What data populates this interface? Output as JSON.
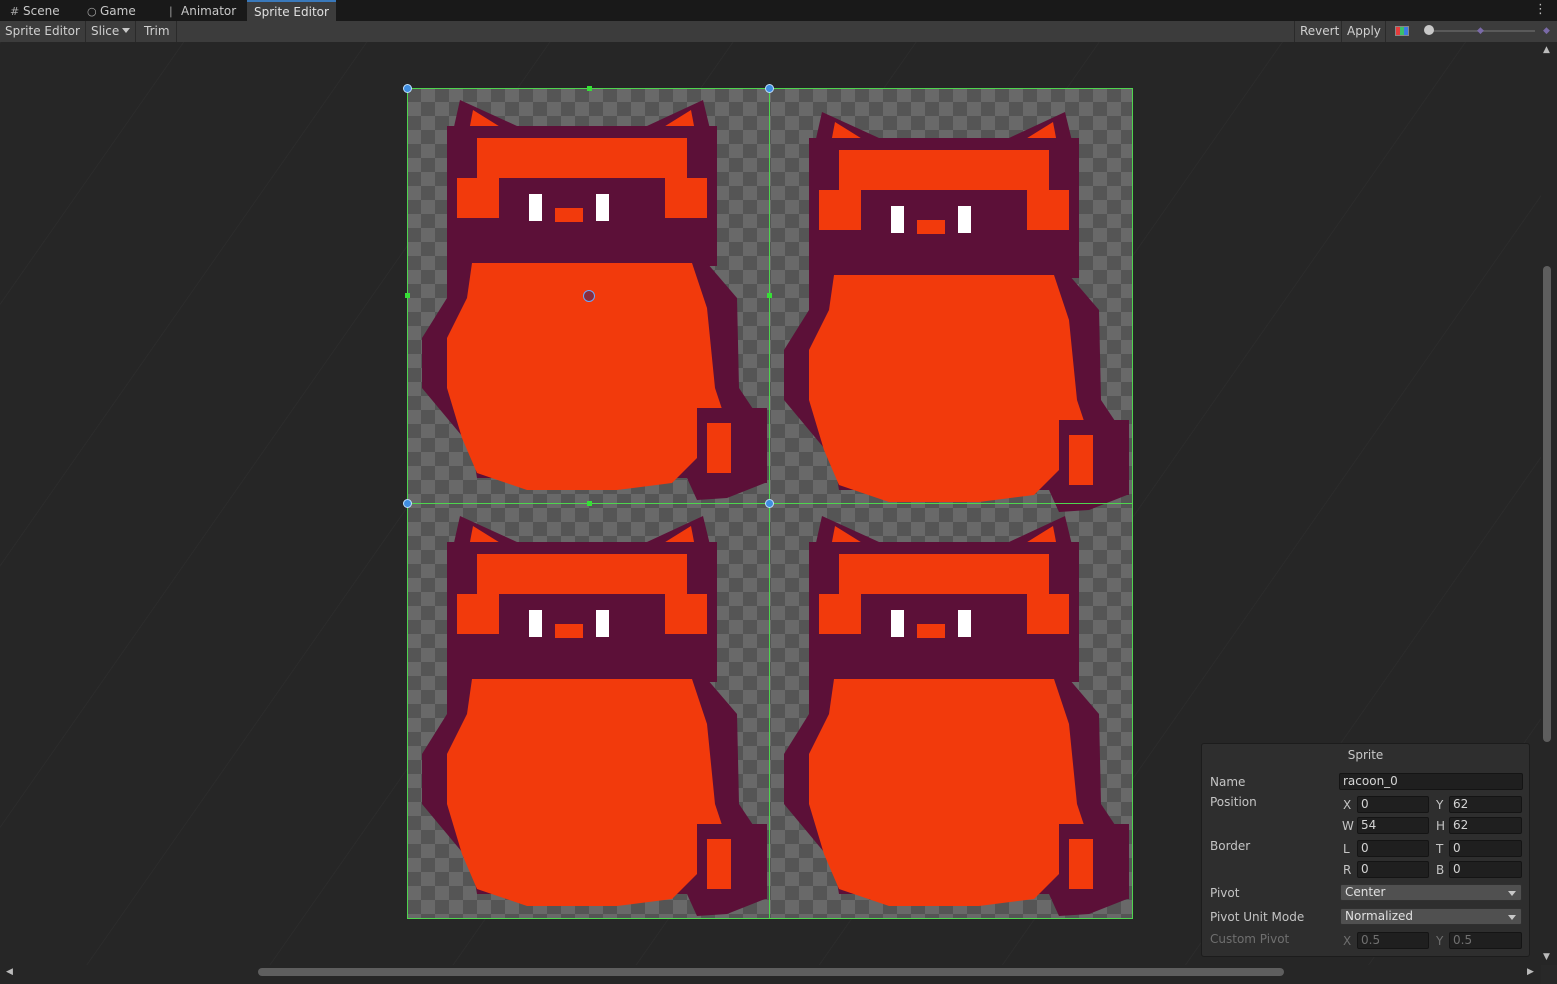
{
  "tabs": [
    {
      "label": "Scene",
      "icon": "grid-icon"
    },
    {
      "label": "Game",
      "icon": "gamepad-icon"
    },
    {
      "label": "Animator",
      "icon": "animator-icon"
    },
    {
      "label": "Sprite Editor",
      "icon": ""
    }
  ],
  "toolbar": {
    "mode_label": "Sprite Editor",
    "slice_label": "Slice",
    "trim_label": "Trim",
    "revert_label": "Revert",
    "apply_label": "Apply"
  },
  "sprite_panel": {
    "title": "Sprite",
    "name_label": "Name",
    "name_value": "racoon_0",
    "position_label": "Position",
    "x_label": "X",
    "x_value": "0",
    "y_label": "Y",
    "y_value": "62",
    "w_label": "W",
    "w_value": "54",
    "h_label": "H",
    "h_value": "62",
    "border_label": "Border",
    "l_label": "L",
    "l_value": "0",
    "t_label": "T",
    "t_value": "0",
    "r_label": "R",
    "r_value": "0",
    "b_label": "B",
    "b_value": "0",
    "pivot_label": "Pivot",
    "pivot_value": "Center",
    "pivot_unit_label": "Pivot Unit Mode",
    "pivot_unit_value": "Normalized",
    "custom_pivot_label": "Custom Pivot",
    "cx_label": "X",
    "cx_value": "0.5",
    "cy_label": "Y",
    "cy_value": "0.5"
  },
  "colors": {
    "accent": "#3a79bb",
    "slice_line": "#4fd44f",
    "sprite_body": "#f23a0c",
    "sprite_outline": "#5c1038",
    "sprite_eye": "#ffffff"
  }
}
